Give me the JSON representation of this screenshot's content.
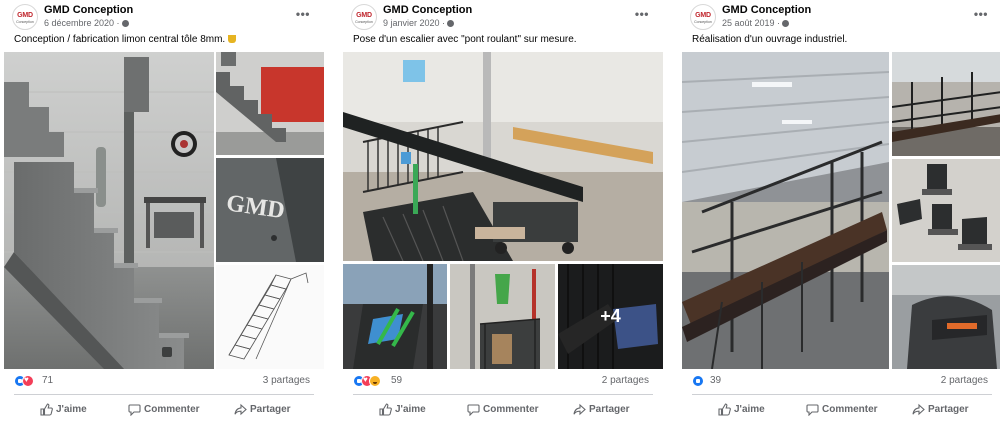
{
  "posts": [
    {
      "page_name": "GMD Conception",
      "avatar_logo": "GMD",
      "avatar_sub": "Conception",
      "date": "6 décembre 2020 ·",
      "caption": "Conception / fabrication limon central tôle 8mm.",
      "reaction_count": "71",
      "reactions": [
        "like",
        "love"
      ],
      "shares": "3 partages",
      "actions": {
        "like": "J'aime",
        "comment": "Commenter",
        "share": "Partager"
      }
    },
    {
      "page_name": "GMD Conception",
      "avatar_logo": "GMD",
      "avatar_sub": "Conception",
      "date": "9 janvier 2020 ·",
      "caption": "Pose d'un escalier avec \"pont roulant\" sur mesure.",
      "reaction_count": "59",
      "reactions": [
        "like",
        "love",
        "haha"
      ],
      "shares": "2 partages",
      "more_photos": "+4",
      "actions": {
        "like": "J'aime",
        "comment": "Commenter",
        "share": "Partager"
      }
    },
    {
      "page_name": "GMD Conception",
      "avatar_logo": "GMD",
      "avatar_sub": "Conception",
      "date": "25 août 2019 ·",
      "caption": "Réalisation d'un ouvrage industriel.",
      "reaction_count": "39",
      "reactions": [
        "like"
      ],
      "shares": "2 partages",
      "actions": {
        "like": "J'aime",
        "comment": "Commenter",
        "share": "Partager"
      }
    }
  ],
  "photo_wall_sign": "GMD",
  "icons": {
    "more": "more-options-icon",
    "globe": "globe-icon",
    "like": "thumbs-up-icon",
    "comment": "comment-icon",
    "share": "share-arrow-icon"
  },
  "colors": {
    "accent": "#1877f2",
    "love": "#f33e58",
    "muted": "#65676b"
  }
}
